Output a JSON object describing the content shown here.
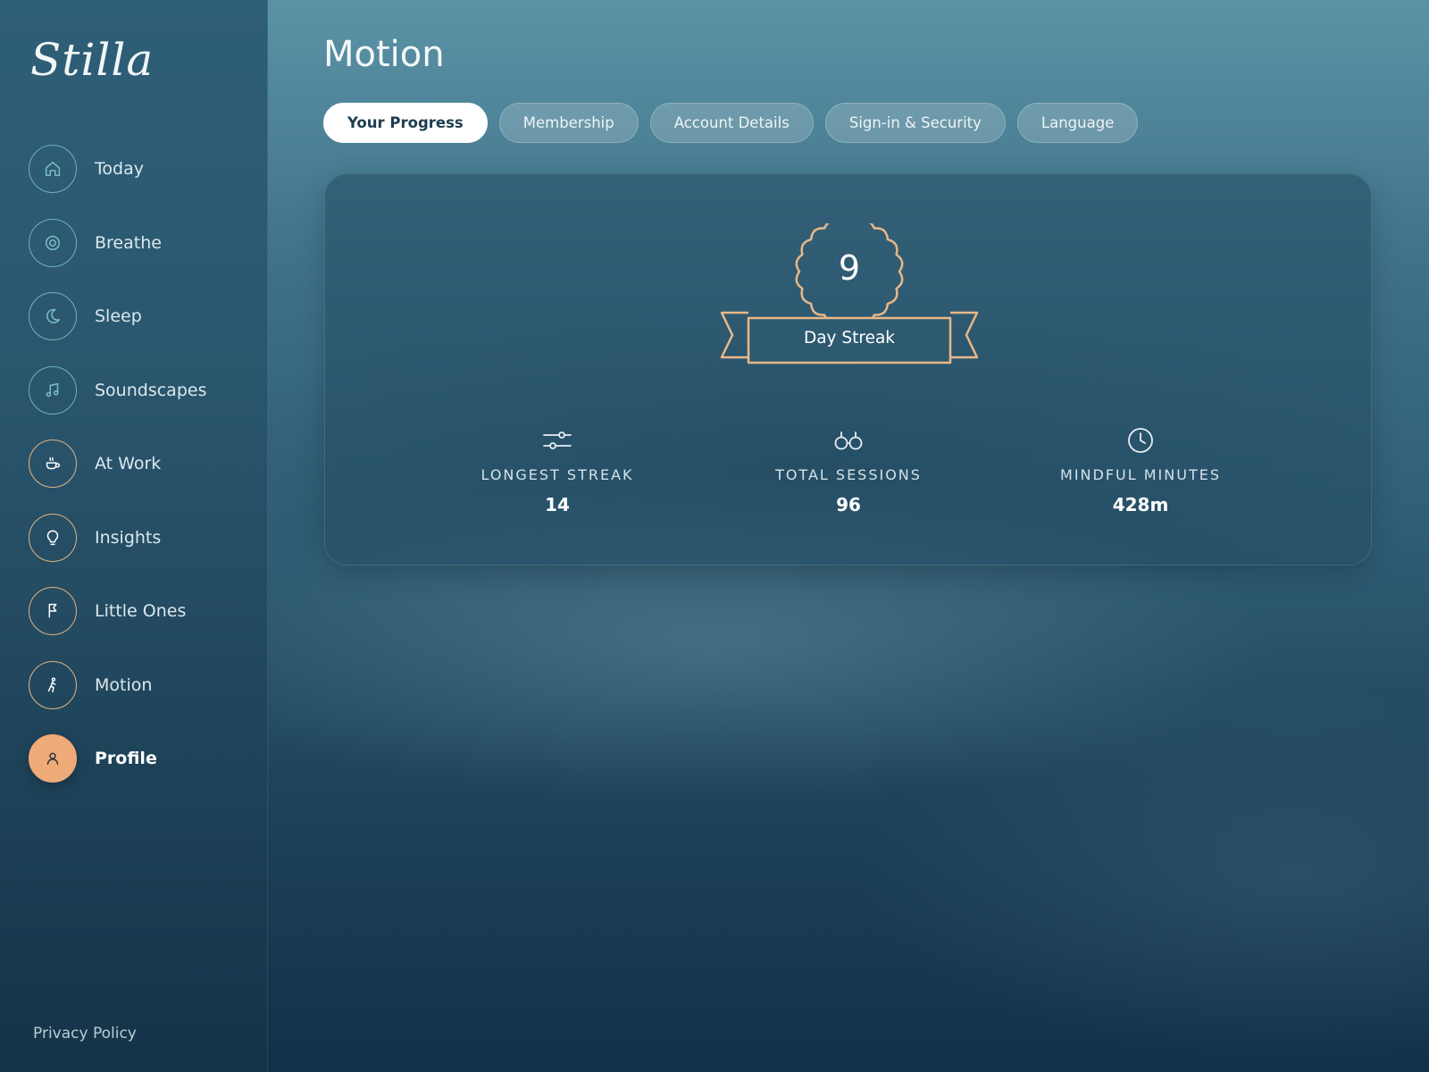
{
  "app": {
    "logo_text": "Stilla"
  },
  "sidebar": {
    "items": [
      {
        "label": "Today",
        "icon": "home-icon"
      },
      {
        "label": "Breathe",
        "icon": "target-icon"
      },
      {
        "label": "Sleep",
        "icon": "moon-icon"
      },
      {
        "label": "Soundscapes",
        "icon": "music-note-icon"
      },
      {
        "label": "At Work",
        "icon": "coffee-cup-icon"
      },
      {
        "label": "Insights",
        "icon": "lightbulb-icon"
      },
      {
        "label": "Little Ones",
        "icon": "flag-icon"
      },
      {
        "label": "Motion",
        "icon": "walking-figure-icon"
      },
      {
        "label": "Profile",
        "icon": "user-icon",
        "active": true
      }
    ],
    "privacy_policy": "Privacy Policy"
  },
  "header": {
    "title": "Motion"
  },
  "tabs": [
    {
      "label": "Your Progress",
      "active": true
    },
    {
      "label": "Membership"
    },
    {
      "label": "Account Details"
    },
    {
      "label": "Sign-in & Security"
    },
    {
      "label": "Language"
    }
  ],
  "progress": {
    "streak_days": "9",
    "streak_label": "Day Streak",
    "stats": [
      {
        "label": "LONGEST STREAK",
        "value": "14",
        "icon": "sliders-icon"
      },
      {
        "label": "TOTAL SESSIONS",
        "value": "96",
        "icon": "glasses-icon"
      },
      {
        "label": "MINDFUL MINUTES",
        "value": "428m",
        "icon": "clock-icon"
      }
    ]
  },
  "colors": {
    "accent_orange": "#eeaa77",
    "badge_stroke": "#e9b886",
    "teal_ring": "#6fb2b8",
    "warm_ring": "#e2b27f"
  }
}
